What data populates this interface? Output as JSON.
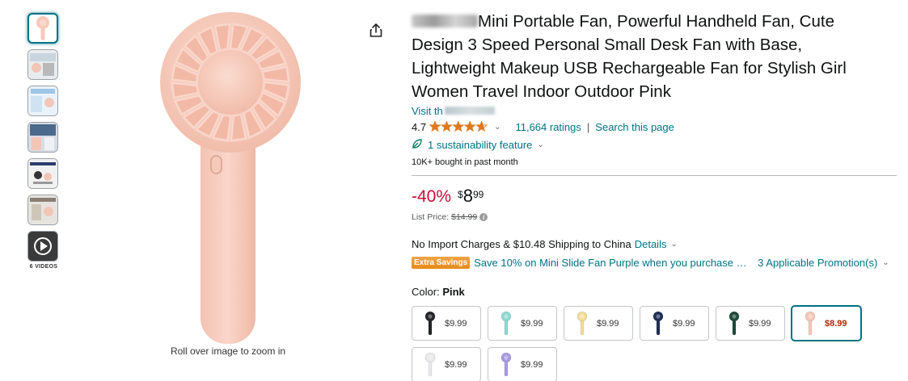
{
  "thumbnails": {
    "items": [
      {
        "name": "thumbnail-fan-pink",
        "selected": true,
        "kind": "image"
      },
      {
        "name": "thumbnail-lifestyle-1",
        "selected": false,
        "kind": "image"
      },
      {
        "name": "thumbnail-lifestyle-2",
        "selected": false,
        "kind": "image"
      },
      {
        "name": "thumbnail-lifestyle-3",
        "selected": false,
        "kind": "image"
      },
      {
        "name": "thumbnail-lifestyle-4",
        "selected": false,
        "kind": "image"
      },
      {
        "name": "thumbnail-lifestyle-5",
        "selected": false,
        "kind": "image"
      },
      {
        "name": "thumbnail-video",
        "selected": false,
        "kind": "video"
      }
    ],
    "videos_label": "6 VIDEOS"
  },
  "main_image": {
    "zoom_hint": "Roll over image to zoom in",
    "product_color": "#f6c9bb"
  },
  "share_icon": "share-icon",
  "product": {
    "title_rest": "Mini Portable Fan, Powerful Handheld Fan, Cute Design 3 Speed Personal Small Desk Fan with Base, Lightweight Makeup USB Rechargeable Fan for Stylish Girl Women Travel Indoor Outdoor Pink",
    "store_prefix": "Visit th",
    "rating_value": "4.7",
    "rating_fraction": 0.94,
    "ratings_count": "11,664 ratings",
    "search_page": "Search this page",
    "sustainability": "1 sustainability feature",
    "bought": "10K+ bought in past month"
  },
  "pricing": {
    "discount": "-40%",
    "currency": "$",
    "whole": "8",
    "fraction": "99",
    "list_price_label": "List Price:",
    "list_price": "$14.99"
  },
  "shipping": {
    "text": "No Import Charges & $10.48 Shipping to China",
    "details": "Details"
  },
  "promotion": {
    "badge": "Extra Savings",
    "text": "Save 10% on Mini Slide Fan Purple when you purchase 1 o...",
    "apply": "3 Applicable Promotion(s)"
  },
  "color": {
    "label": "Color:",
    "selected_name": "Pink",
    "options": [
      {
        "price": "$9.99",
        "fan_color": "#222428",
        "selected": false
      },
      {
        "price": "$9.99",
        "fan_color": "#8fd9d0",
        "selected": false
      },
      {
        "price": "$9.99",
        "fan_color": "#f3dc9a",
        "selected": false
      },
      {
        "price": "$9.99",
        "fan_color": "#1f2f55",
        "selected": false
      },
      {
        "price": "$9.99",
        "fan_color": "#1e4a3a",
        "selected": false
      },
      {
        "price": "$8.99",
        "fan_color": "#f4c6b8",
        "selected": true
      },
      {
        "price": "$9.99",
        "fan_color": "#e9e9ec",
        "selected": false
      },
      {
        "price": "$9.99",
        "fan_color": "#a99be0",
        "selected": false
      }
    ]
  },
  "colors": {
    "link": "#007185",
    "discount": "#cc0c39",
    "star": "#de7921",
    "badge": "#e88a1a"
  }
}
